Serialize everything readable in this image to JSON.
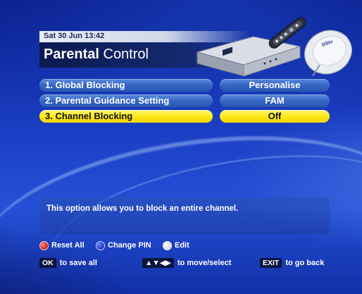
{
  "header": {
    "datetime": "Sat 30 Jun 13:42",
    "title_bold": "Parental",
    "title_rest": " Control"
  },
  "menu": {
    "rows": [
      {
        "label": "1. Global Blocking",
        "value": "Personalise",
        "selected": false
      },
      {
        "label": "2. Parental Guidance Setting",
        "value": "FAM",
        "selected": false
      },
      {
        "label": "3. Channel Blocking",
        "value": "Off",
        "selected": true
      }
    ]
  },
  "info": {
    "text": "This option allows you to block an entire channel."
  },
  "color_keys": [
    {
      "color": "red",
      "label": "Reset All"
    },
    {
      "color": "blue",
      "label": "Change PIN"
    },
    {
      "color": "white",
      "label": "Edit"
    }
  ],
  "hints": [
    {
      "key": "OK",
      "text": "to save all"
    },
    {
      "key": "▲▼◀▶",
      "text": "to move/select"
    },
    {
      "key": "EXIT",
      "text": "to go back"
    }
  ],
  "colors": {
    "selected_row": "#fde81a",
    "normal_row": "#3566c4",
    "background": "#1b3fc4"
  },
  "icons": {
    "decoder_art": "decoder-with-remote-and-dish-icon"
  }
}
